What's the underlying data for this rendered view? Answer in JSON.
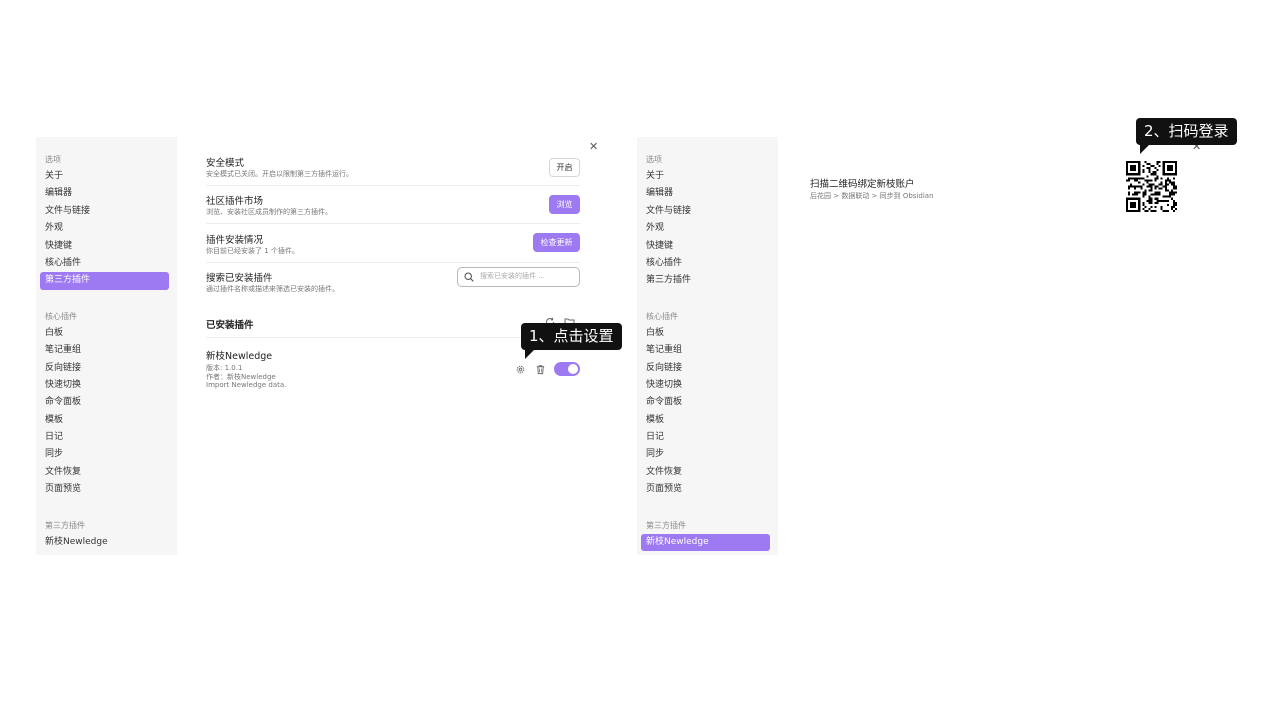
{
  "left_panel": {
    "sidebar": {
      "options_title": "选项",
      "options": [
        "关于",
        "编辑器",
        "文件与链接",
        "外观",
        "快捷键",
        "核心插件",
        "第三方插件"
      ],
      "active_option_index": 6,
      "core_title": "核心插件",
      "core_items": [
        "白板",
        "笔记重组",
        "反向链接",
        "快速切换",
        "命令面板",
        "模板",
        "日记",
        "同步",
        "文件恢复",
        "页面预览"
      ],
      "third_title": "第三方插件",
      "third_items": [
        "新枝Newledge"
      ]
    },
    "settings": [
      {
        "name": "安全模式",
        "desc": "安全模式已关闭。开启以限制第三方插件运行。",
        "button": "开启",
        "style": "plain"
      },
      {
        "name": "社区插件市场",
        "desc": "浏览、安装社区成员制作的第三方插件。",
        "button": "浏览",
        "style": "accent"
      },
      {
        "name": "插件安装情况",
        "desc": "你目前已经安装了 1 个插件。",
        "button": "检查更新",
        "style": "accent"
      },
      {
        "name": "搜索已安装插件",
        "desc": "通过插件名称或描述来筛选已安装的插件。",
        "search_placeholder": "搜索已安装的插件 ..."
      }
    ],
    "installed_title": "已安装插件",
    "plugin": {
      "name": "新枝Newledge",
      "version": "版本: 1.0.1",
      "author": "作者：新枝Newledge",
      "description": "Import Newledge data.",
      "enabled": true
    },
    "callout": "1、点击设置"
  },
  "right_panel": {
    "sidebar": {
      "options_title": "选项",
      "options": [
        "关于",
        "编辑器",
        "文件与链接",
        "外观",
        "快捷键",
        "核心插件",
        "第三方插件"
      ],
      "core_title": "核心插件",
      "core_items": [
        "白板",
        "笔记重组",
        "反向链接",
        "快速切换",
        "命令面板",
        "模板",
        "日记",
        "同步",
        "文件恢复",
        "页面预览"
      ],
      "third_title": "第三方插件",
      "third_items": [
        "新枝Newledge"
      ],
      "active_third_index": 0
    },
    "bind_title": "扫描二维码绑定新枝账户",
    "bind_desc": "后花园 > 数据联动 > 同步到 Obsidian",
    "callout": "2、扫码登录"
  },
  "icons": {
    "close": "close-icon",
    "refresh": "refresh-icon",
    "folder": "folder-icon",
    "gear": "gear-icon",
    "trash": "trash-icon",
    "search": "search-icon",
    "qr": "qr-code"
  },
  "colors": {
    "accent": "#9d7af2",
    "sidebar_bg": "#f6f6f6",
    "callout_bg": "#111111"
  }
}
